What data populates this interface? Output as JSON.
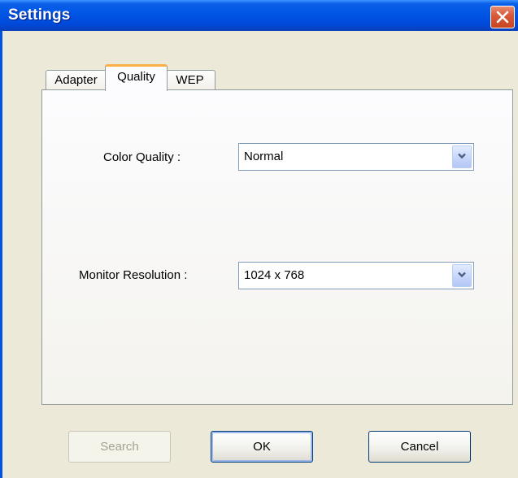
{
  "window": {
    "title": "Settings"
  },
  "tabs": [
    {
      "label": "Adapter",
      "selected": false
    },
    {
      "label": "Quality",
      "selected": true
    },
    {
      "label": "WEP",
      "selected": false
    }
  ],
  "quality": {
    "color_quality": {
      "label": "Color Quality :",
      "value": "Normal"
    },
    "monitor_resolution": {
      "label": "Monitor Resolution :",
      "value": "1024 x 768"
    }
  },
  "buttons": {
    "search": {
      "label": "Search",
      "enabled": false
    },
    "ok": {
      "label": "OK",
      "enabled": true,
      "default": true
    },
    "cancel": {
      "label": "Cancel",
      "enabled": true
    }
  },
  "icons": {
    "close": "close-icon",
    "dropdown": "chevron-down-icon"
  },
  "colors": {
    "titlebar": "#0055e5",
    "dialog_background": "#ece9d8",
    "close_button": "#d95a3c",
    "selected_tab_accent": "#f9b145"
  }
}
